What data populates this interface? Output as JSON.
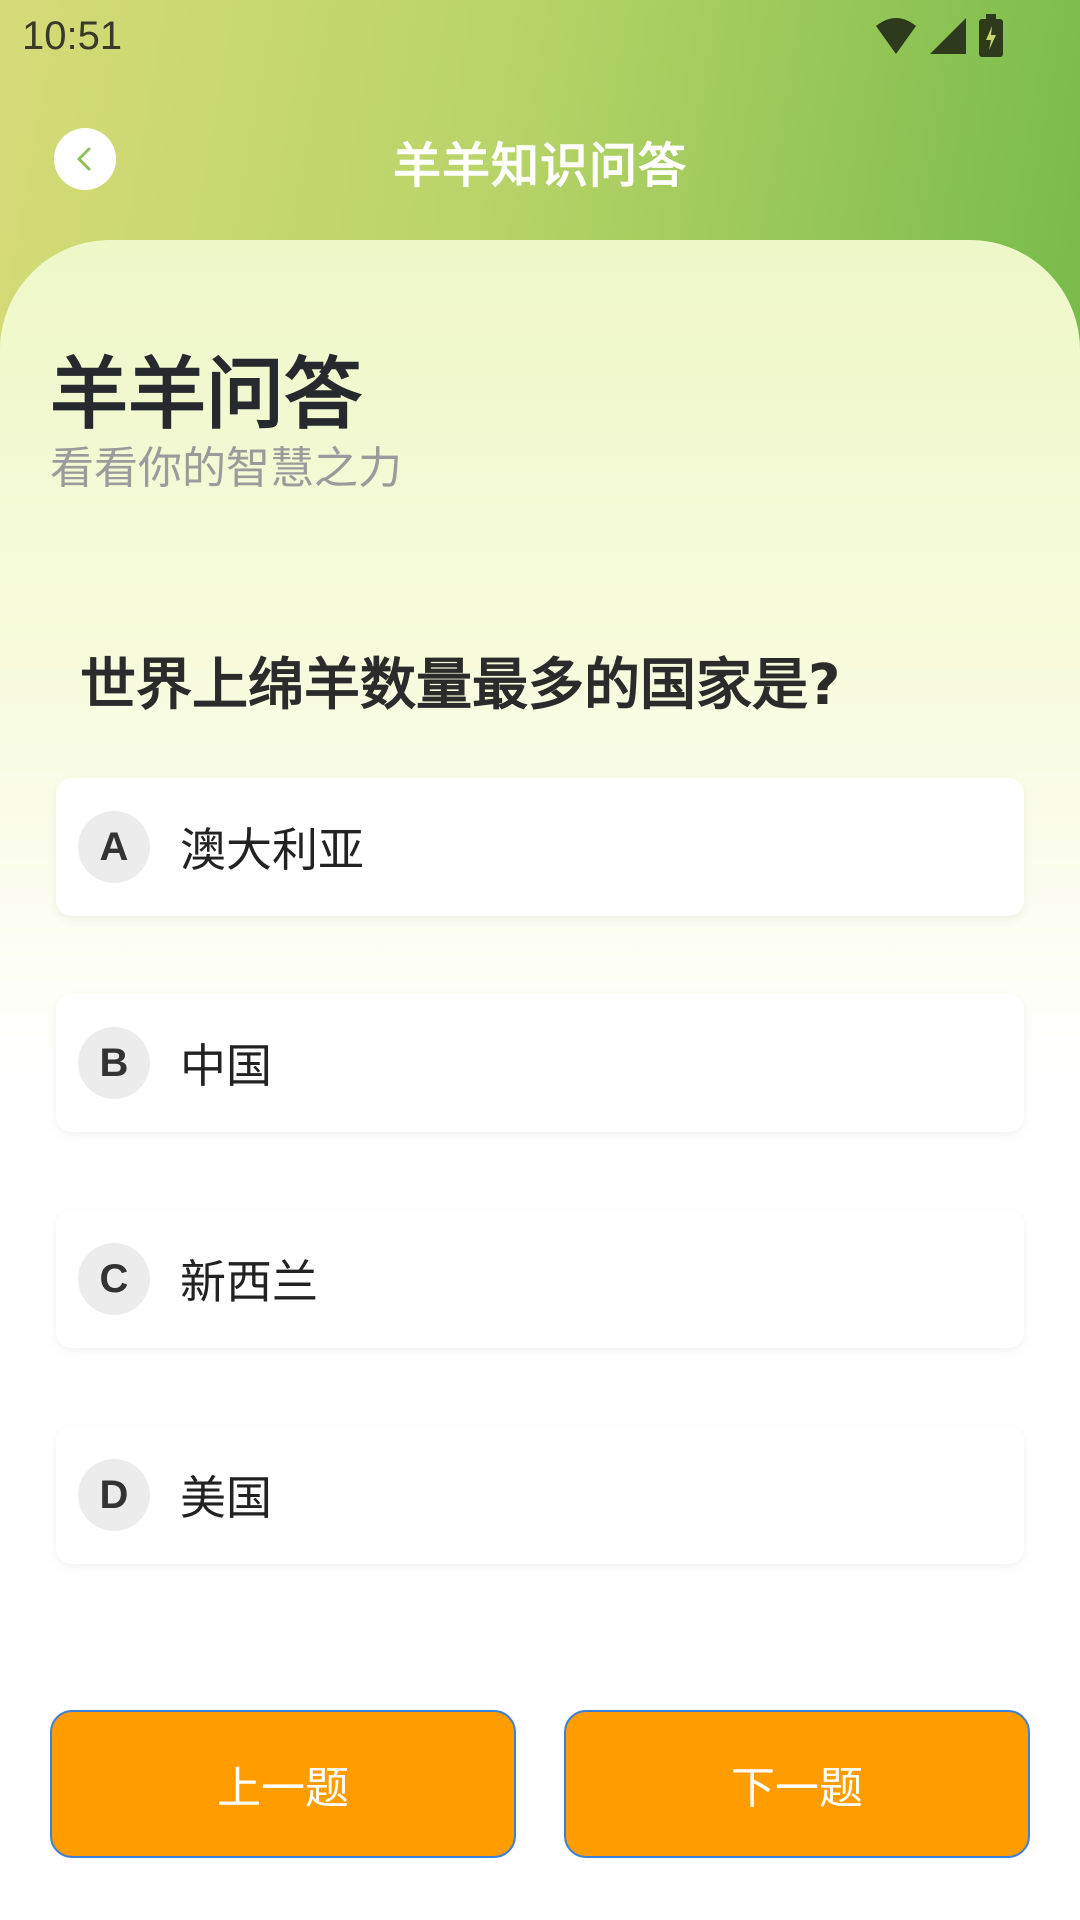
{
  "status_bar": {
    "time": "10:51"
  },
  "nav": {
    "title": "羊羊知识问答"
  },
  "quiz": {
    "title": "羊羊问答",
    "subtitle": "看看你的智慧之力",
    "question": "世界上绵羊数量最多的国家是?"
  },
  "options": [
    {
      "letter": "A",
      "text": "澳大利亚"
    },
    {
      "letter": "B",
      "text": "中国"
    },
    {
      "letter": "C",
      "text": "新西兰"
    },
    {
      "letter": "D",
      "text": "美国"
    }
  ],
  "buttons": {
    "prev": "上一题",
    "next": "下一题"
  },
  "colors": {
    "accent": "#ff9c00",
    "header_start": "#d6db78",
    "header_end": "#77bb4a"
  }
}
